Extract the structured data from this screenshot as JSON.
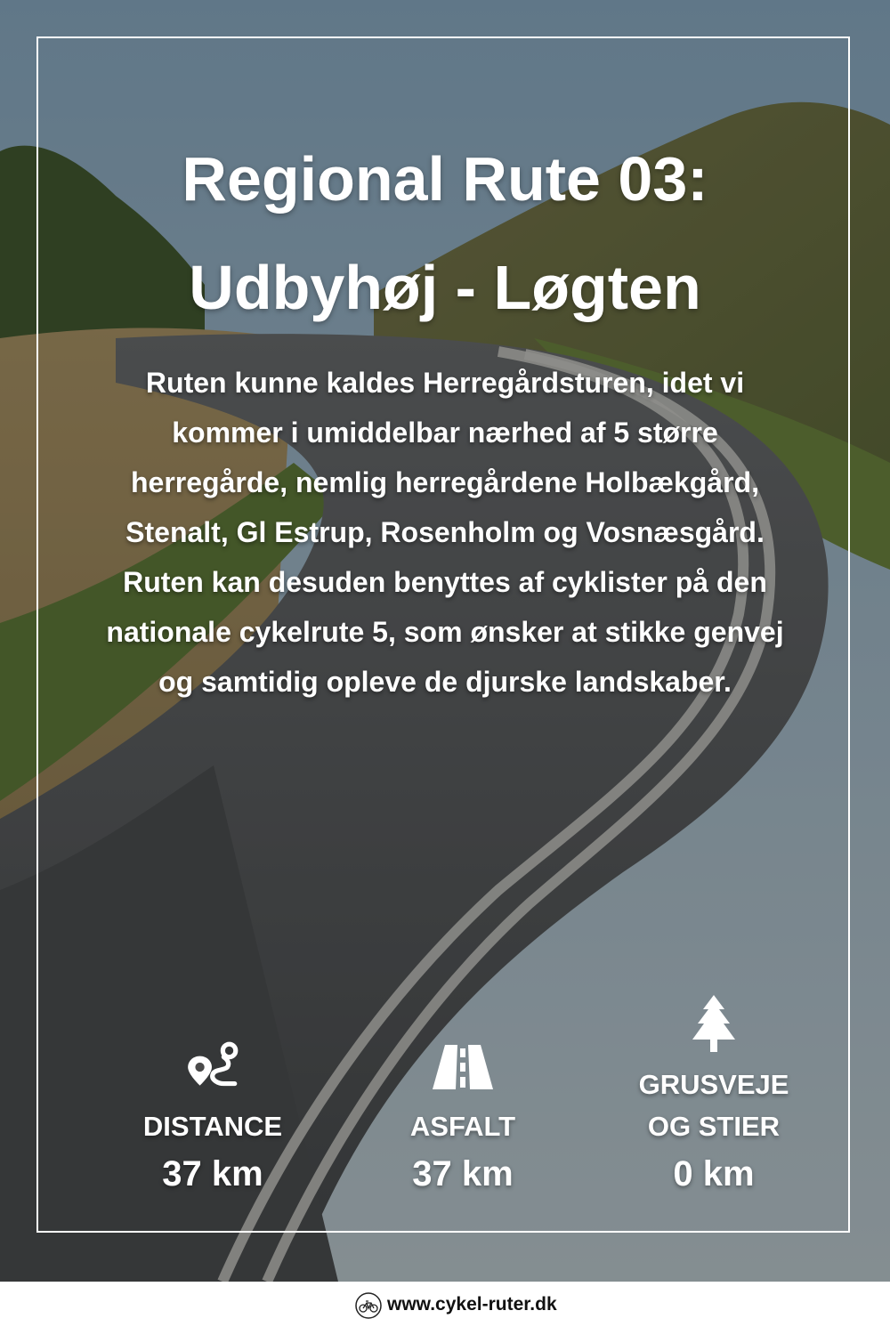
{
  "title_lines": [
    "Regional Rute 03:",
    "Udbyhøj - Løgten"
  ],
  "description": "Ruten kunne kaldes Herregårdsturen, idet vi kommer i umiddelbar nærhed af 5 større herregårde, nemlig herregårdene Holbækgård, Stenalt, Gl Estrup, Rosenholm og Vosnæsgård. Ruten kan desuden benyttes af cyklister på den nationale cykelrute 5, som ønsker at stikke genvej og samtidig opleve de djurske landskaber.",
  "stats": [
    {
      "icon": "route-icon",
      "label": "DISTANCE",
      "value": "37 km"
    },
    {
      "icon": "road-icon",
      "label": "ASFALT",
      "value": "37 km"
    },
    {
      "icon": "tree-icon",
      "label_lines": [
        "GRUSVEJE",
        "OG STIER"
      ],
      "value": "0 km"
    }
  ],
  "footer": {
    "icon": "bicycle-logo-icon",
    "url": "www.cykel-ruter.dk"
  },
  "colors": {
    "text": "#ffffff",
    "overlay": "#141414",
    "footer_bg": "#ffffff",
    "footer_text": "#111111"
  }
}
